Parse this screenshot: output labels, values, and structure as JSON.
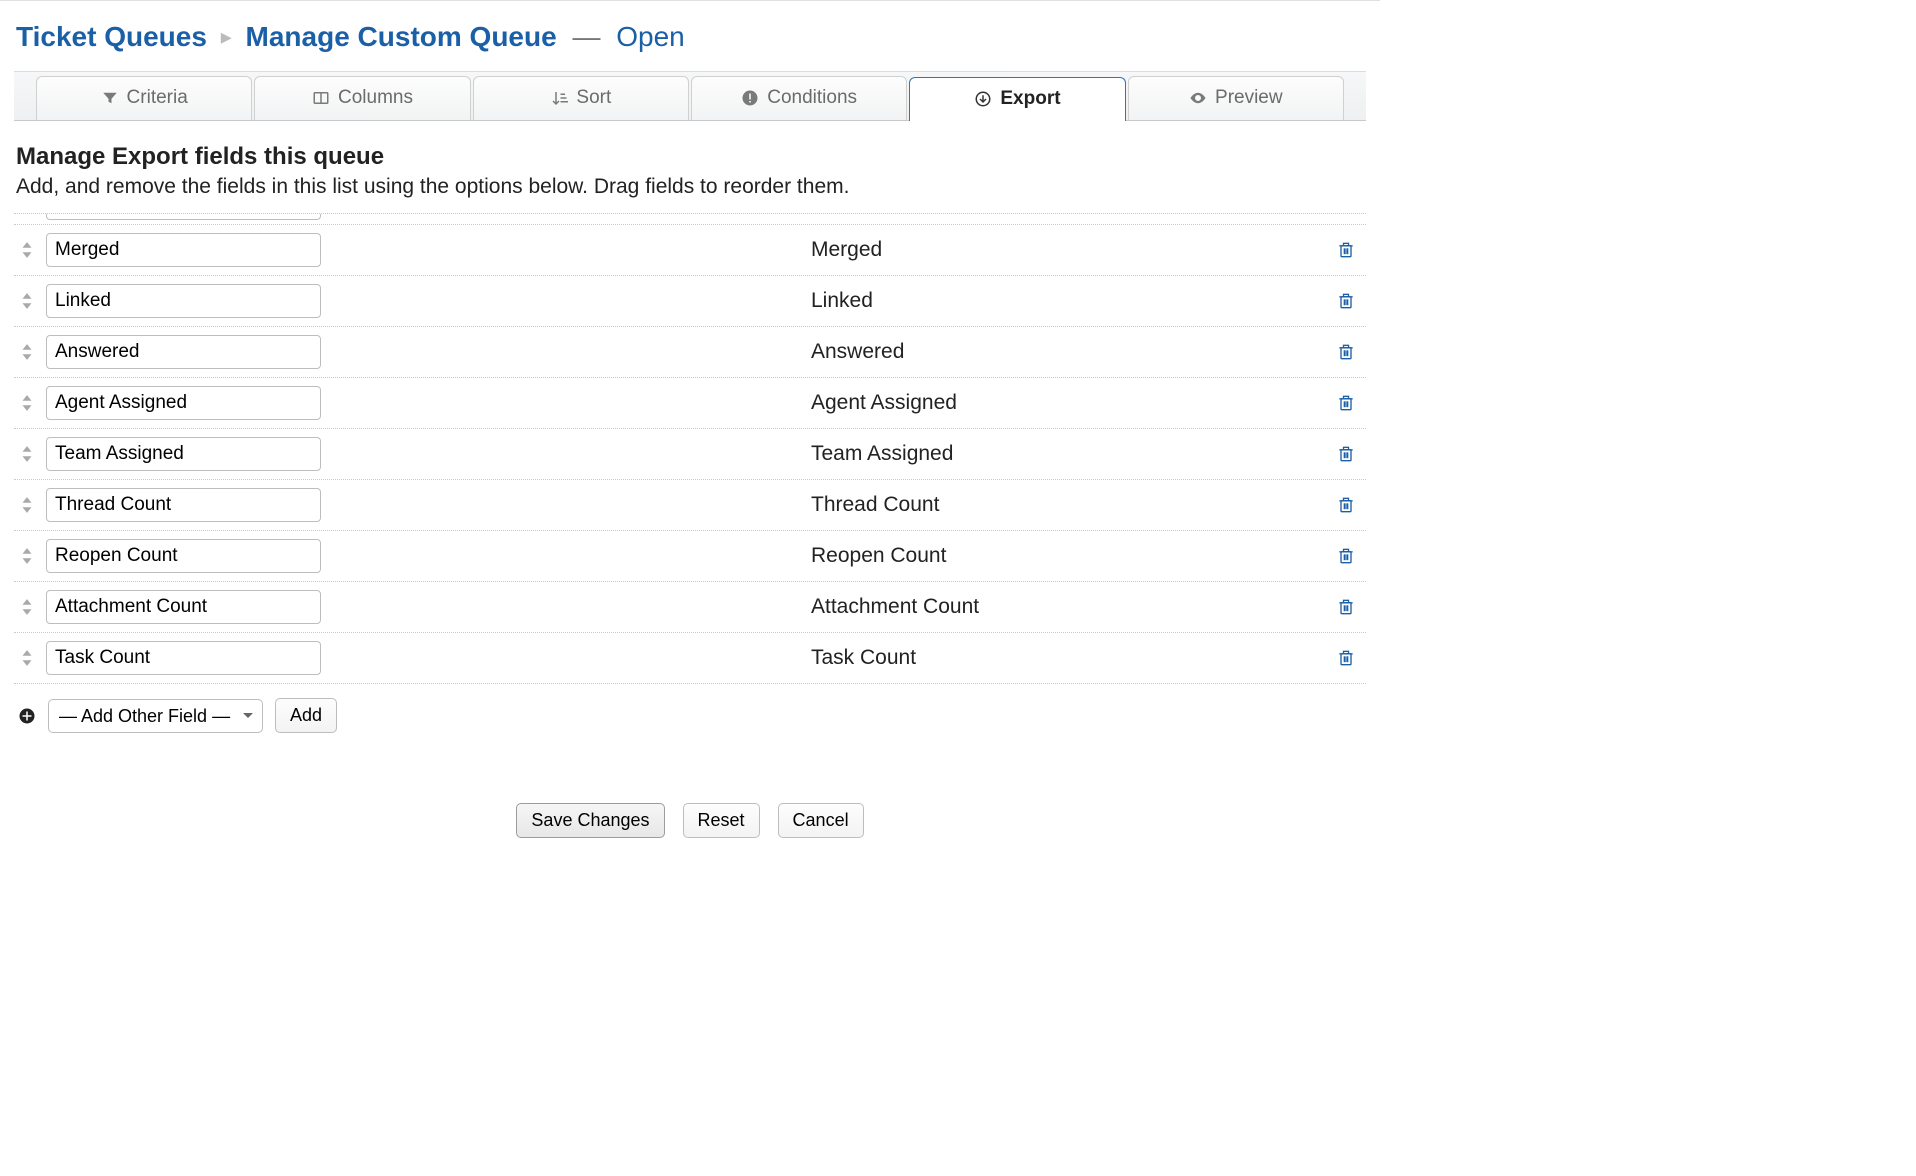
{
  "breadcrumb": {
    "root": "Ticket Queues",
    "current": "Manage Custom Queue",
    "status": "Open"
  },
  "tabs": [
    {
      "label": "Criteria",
      "icon": "filter-icon"
    },
    {
      "label": "Columns",
      "icon": "columns-icon"
    },
    {
      "label": "Sort",
      "icon": "sort-icon"
    },
    {
      "label": "Conditions",
      "icon": "warning-icon"
    },
    {
      "label": "Export",
      "icon": "download-icon"
    },
    {
      "label": "Preview",
      "icon": "eye-icon"
    }
  ],
  "active_tab": "Export",
  "section": {
    "title": "Manage Export fields this queue",
    "desc": "Add, and remove the fields in this list using the options below. Drag fields to reorder them."
  },
  "fields": [
    {
      "input": "Merged",
      "label": "Merged"
    },
    {
      "input": "Linked",
      "label": "Linked"
    },
    {
      "input": "Answered",
      "label": "Answered"
    },
    {
      "input": "Agent Assigned",
      "label": "Agent Assigned"
    },
    {
      "input": "Team Assigned",
      "label": "Team Assigned"
    },
    {
      "input": "Thread Count",
      "label": "Thread Count"
    },
    {
      "input": "Reopen Count",
      "label": "Reopen Count"
    },
    {
      "input": "Attachment Count",
      "label": "Attachment Count"
    },
    {
      "input": "Task Count",
      "label": "Task Count"
    }
  ],
  "add_field": {
    "placeholder": "— Add Other Field —",
    "button": "Add"
  },
  "actions": {
    "save": "Save Changes",
    "reset": "Reset",
    "cancel": "Cancel"
  }
}
